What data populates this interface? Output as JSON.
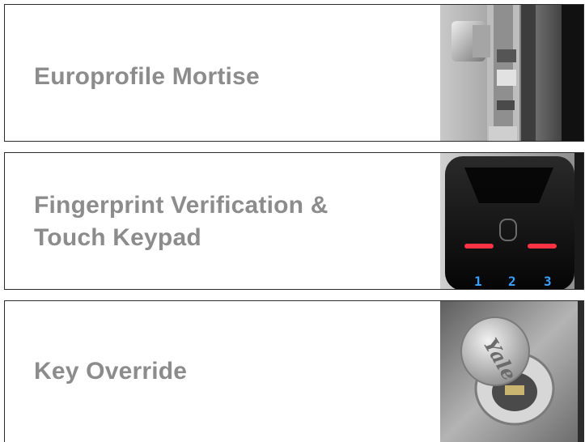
{
  "features": [
    {
      "label": "Europrofile Mortise",
      "image": "mortise-lock-photo"
    },
    {
      "label": "Fingerprint Verification & Touch Keypad",
      "label_line1": "Fingerprint Verification &",
      "label_line2": "Touch Keypad",
      "image": "fingerprint-keypad-photo"
    },
    {
      "label": "Key Override",
      "image": "key-override-photo",
      "brand": "Yale"
    }
  ],
  "keypad_digits": [
    "1",
    "2",
    "3"
  ],
  "colors": {
    "label": "#8c8c8c",
    "border": "#2b2b2b",
    "keypad_glow": "#3aa0ff",
    "indicator_red": "#ff3344"
  }
}
